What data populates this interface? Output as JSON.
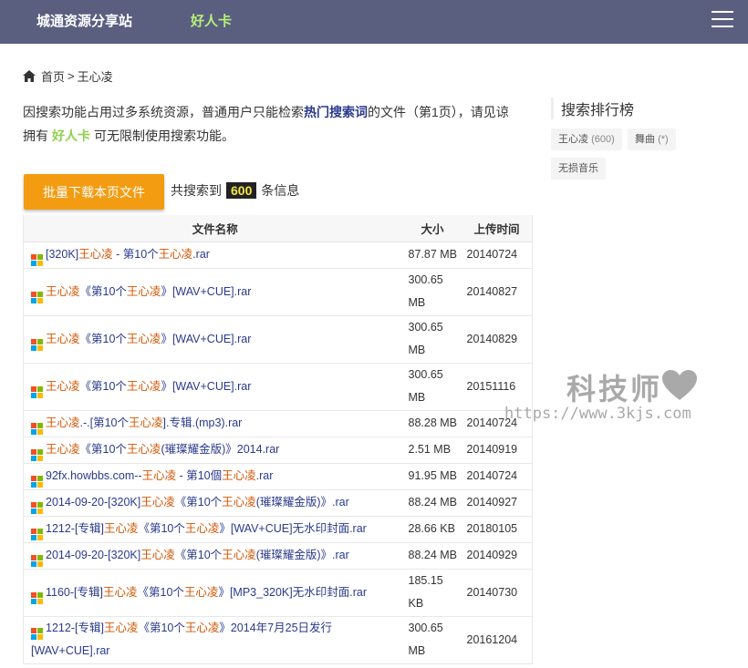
{
  "header": {
    "site_title": "城通资源分享站",
    "card_link": "好人卡"
  },
  "breadcrumb": {
    "home": "首页",
    "separator": ">",
    "current": "王心凌"
  },
  "notice": {
    "part1": "因搜索功能占用过多系统资源，普通用户只能检索",
    "hot": "热门搜索词",
    "part2": "的文件（第1页），请见谅",
    "line2_a": "拥有",
    "card": "好人卡",
    "line2_b": "可无限制使用搜索功能。"
  },
  "bulk_button": "批量下载本页文件",
  "total": {
    "prefix": "共搜索到",
    "count": "600",
    "suffix": "条信息"
  },
  "table": {
    "headers": [
      "文件名称",
      "大小",
      "上传时间"
    ],
    "rows": [
      {
        "parts": [
          [
            "p",
            "[320K]"
          ],
          [
            "k",
            "王心凌"
          ],
          [
            "p",
            " - 第10个"
          ],
          [
            "k",
            "王心凌"
          ],
          [
            "p",
            ".rar"
          ]
        ],
        "size": "87.87 MB",
        "date": "20140724"
      },
      {
        "parts": [
          [
            "k",
            "王心凌"
          ],
          [
            "p",
            "《第10个"
          ],
          [
            "k",
            "王心凌"
          ],
          [
            "p",
            "》[WAV+CUE].rar"
          ]
        ],
        "size": "300.65 MB",
        "date": "20140827"
      },
      {
        "parts": [
          [
            "k",
            "王心凌"
          ],
          [
            "p",
            "《第10个"
          ],
          [
            "k",
            "王心凌"
          ],
          [
            "p",
            "》[WAV+CUE].rar"
          ]
        ],
        "size": "300.65 MB",
        "date": "20140829"
      },
      {
        "parts": [
          [
            "k",
            "王心凌"
          ],
          [
            "p",
            "《第10个"
          ],
          [
            "k",
            "王心凌"
          ],
          [
            "p",
            "》[WAV+CUE].rar"
          ]
        ],
        "size": "300.65 MB",
        "date": "20151116"
      },
      {
        "parts": [
          [
            "k",
            "王心凌"
          ],
          [
            "p",
            ".-.[第10个"
          ],
          [
            "k",
            "王心凌"
          ],
          [
            "p",
            "].专辑.(mp3).rar"
          ]
        ],
        "size": "88.28 MB",
        "date": "20140724"
      },
      {
        "parts": [
          [
            "k",
            "王心凌"
          ],
          [
            "p",
            "《第10个"
          ],
          [
            "k",
            "王心凌"
          ],
          [
            "p",
            "(璀璨耀金版)》2014.rar"
          ]
        ],
        "size": "2.51 MB",
        "date": "20140919"
      },
      {
        "parts": [
          [
            "p",
            "92fx.howbbs.com--"
          ],
          [
            "k",
            "王心凌"
          ],
          [
            "p",
            " - 第10個"
          ],
          [
            "k",
            "王心凌"
          ],
          [
            "p",
            ".rar"
          ]
        ],
        "size": "91.95 MB",
        "date": "20140724"
      },
      {
        "parts": [
          [
            "p",
            "2014-09-20-[320K]"
          ],
          [
            "k",
            "王心凌"
          ],
          [
            "p",
            "《第10个"
          ],
          [
            "k",
            "王心凌"
          ],
          [
            "p",
            "(璀璨耀金版)》.rar"
          ]
        ],
        "size": "88.24 MB",
        "date": "20140927"
      },
      {
        "parts": [
          [
            "p",
            "1212-[专辑]"
          ],
          [
            "k",
            "王心凌"
          ],
          [
            "p",
            "《第10个"
          ],
          [
            "k",
            "王心凌"
          ],
          [
            "p",
            "》[WAV+CUE]无水印封面.rar"
          ]
        ],
        "size": "28.66 KB",
        "date": "20180105"
      },
      {
        "parts": [
          [
            "p",
            "2014-09-20-[320K]"
          ],
          [
            "k",
            "王心凌"
          ],
          [
            "p",
            "《第10个"
          ],
          [
            "k",
            "王心凌"
          ],
          [
            "p",
            "(璀璨耀金版)》.rar"
          ]
        ],
        "size": "88.24 MB",
        "date": "20140929"
      },
      {
        "parts": [
          [
            "p",
            "1160-[专辑]"
          ],
          [
            "k",
            "王心凌"
          ],
          [
            "p",
            "《第10个"
          ],
          [
            "k",
            "王心凌"
          ],
          [
            "p",
            "》[MP3_320K]无水印封面.rar"
          ]
        ],
        "size": "185.15 KB",
        "date": "20140730"
      },
      {
        "parts": [
          [
            "p",
            "1212-[专辑]"
          ],
          [
            "k",
            "王心凌"
          ],
          [
            "p",
            "《第10个"
          ],
          [
            "k",
            "王心凌"
          ],
          [
            "p",
            "》2014年7月25日发行 [WAV+CUE].rar"
          ]
        ],
        "size": "300.65 MB",
        "date": "20161204"
      }
    ]
  },
  "sidebar": {
    "title": "搜索排行榜",
    "tags": [
      {
        "label": "王心凌",
        "count": "(600)"
      },
      {
        "label": "舞曲",
        "count": "(*)"
      },
      {
        "label": "无损音乐",
        "count": ""
      }
    ]
  },
  "watermark": {
    "text": "科技师",
    "url": "https://www.3kjs.com"
  },
  "colors": {
    "header_bg": "#5a5f80",
    "accent_orange": "#f39c12",
    "keyword": "#d35400",
    "link": "#2a3a8c",
    "card_green": "#8fd14f"
  }
}
